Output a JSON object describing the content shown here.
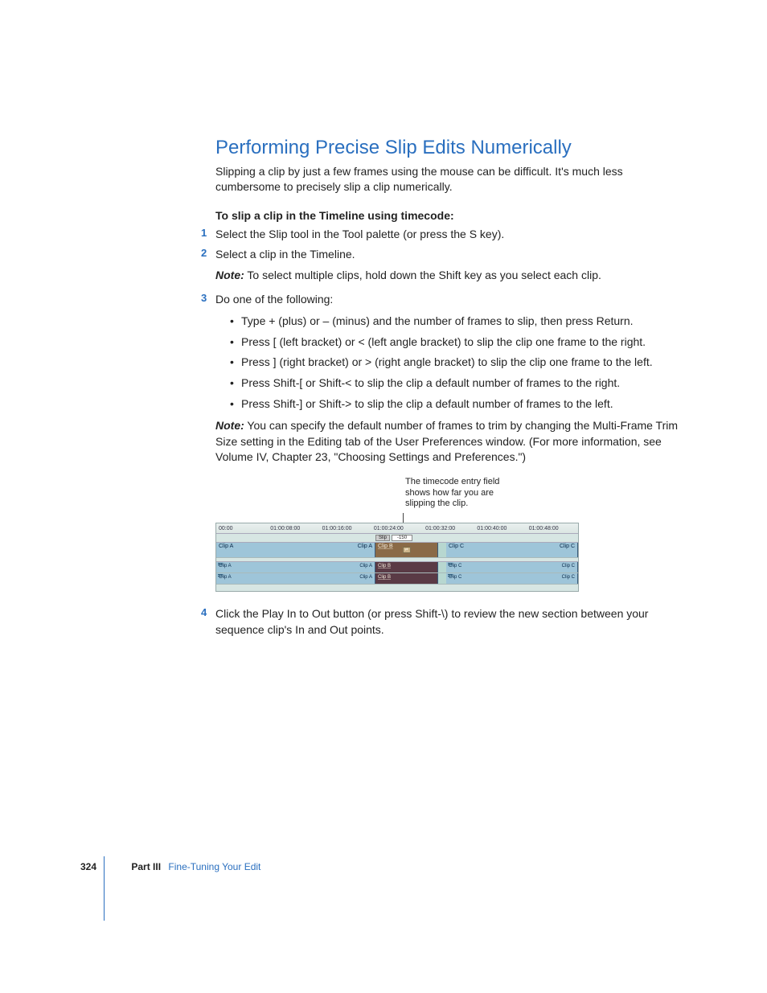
{
  "heading": "Performing Precise Slip Edits Numerically",
  "intro": "Slipping a clip by just a few frames using the mouse can be difficult. It's much less cumbersome to precisely slip a clip numerically.",
  "subhead": "To slip a clip in the Timeline using timecode:",
  "steps": {
    "s1": {
      "num": "1",
      "text": "Select the Slip tool in the Tool palette (or press the S key)."
    },
    "s2": {
      "num": "2",
      "text": "Select a clip in the Timeline."
    },
    "s2note_label": "Note:",
    "s2note": " To select multiple clips, hold down the Shift key as you select each clip.",
    "s3": {
      "num": "3",
      "text": "Do one of the following:"
    },
    "bullets": {
      "b1": "Type + (plus) or – (minus) and the number of frames to slip, then press Return.",
      "b2": "Press [ (left bracket) or < (left angle bracket) to slip the clip one frame to the right.",
      "b3": "Press ] (right bracket) or > (right angle bracket) to slip the clip one frame to the left.",
      "b4": "Press Shift-[ or Shift-< to slip the clip a default number of frames to the right.",
      "b5": "Press Shift-] or Shift-> to slip the clip a default number of frames to the left."
    },
    "s3note_label": "Note:",
    "s3note": " You can specify the default number of frames to trim by changing the Multi-Frame Trim Size setting in the Editing tab of the User Preferences window. (For more information, see Volume IV, Chapter 23, \"Choosing Settings and Preferences.\")",
    "s4": {
      "num": "4",
      "text": "Click the Play In to Out button (or press Shift-\\) to review the new section between your sequence clip's In and Out points."
    }
  },
  "figure": {
    "callout": "The timecode entry field shows how far you are slipping the clip.",
    "ruler": [
      "00:00",
      "01:00:08:00",
      "01:00:16:00",
      "01:00:24:00",
      "01:00:32:00",
      "01:00:40:00",
      "01:00:48:00"
    ],
    "slip_label": "Slip",
    "slip_value": "-150",
    "clipA": "Clip A",
    "clipB": "Clip B",
    "clipC": "Clip C"
  },
  "footer": {
    "page": "324",
    "part": "Part III",
    "section": "Fine-Tuning Your Edit"
  }
}
